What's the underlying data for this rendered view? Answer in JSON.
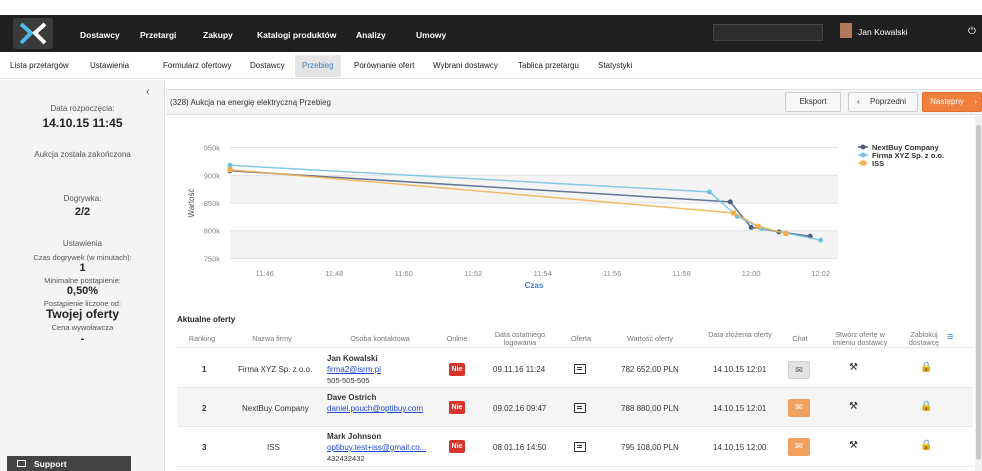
{
  "topnav": {
    "items": [
      "Dostawcy",
      "Przetargi",
      "Zakupy",
      "Katalogi produktów",
      "Analizy",
      "Umowy"
    ],
    "active": "Przetargi",
    "user_name": "Jan Kowalski"
  },
  "subnav": {
    "items": [
      "Lista przetargów",
      "Ustawienia",
      "Formularz ofertowy",
      "Dostawcy",
      "Przebieg",
      "Porównanie ofert",
      "Wybrani dostawcy",
      "Tablica przetargu",
      "Statystyki"
    ],
    "active": "Przebieg"
  },
  "sidebar": {
    "start_label": "Data rozpoczęcia:",
    "start_value": "14.10.15 11:45",
    "status": "Aukcja została zakończona",
    "overtime_label": "Dogrywka:",
    "overtime_value": "2/2",
    "settings_title": "Ustawienia",
    "overtime_time_label": "Czas dogrywek (w minutach):",
    "overtime_time_value": "1",
    "min_step_label": "Minimalne postąpienie:",
    "min_step_value": "0,50%",
    "step_from_label": "Postąpienie liczone od:",
    "step_from_value": "Twojej oferty",
    "start_price_label": "Cena wywoławcza",
    "start_price_value": "-",
    "support_label": "Support"
  },
  "header": {
    "title": "(328) Aukcja na energię elektryczną Przebieg",
    "export_label": "Eksport",
    "prev_label": "Poprzedni",
    "next_label": "Następny"
  },
  "chart_data": {
    "type": "line",
    "xlabel": "Czas",
    "ylabel": "Wartość",
    "x_ticks": [
      "11:46",
      "11:48",
      "11:50",
      "11:52",
      "11:54",
      "11:56",
      "11:58",
      "12:00",
      "12:02"
    ],
    "y_ticks": [
      "750k",
      "800k",
      "850k",
      "900k",
      "950k"
    ],
    "ylim": [
      740000,
      960000
    ],
    "xlim": [
      "11:45",
      "12:02.5"
    ],
    "grid": true,
    "legend_position": "top-right",
    "series": [
      {
        "name": "NextBuy Company",
        "color": "#4a5f80",
        "points": [
          [
            "11:45",
            908000
          ],
          [
            "11:59.4",
            852000
          ],
          [
            "12:00",
            806000
          ],
          [
            "12:00.8",
            798000
          ],
          [
            "12:01.7",
            790000
          ]
        ]
      },
      {
        "name": "Firma XYZ Sp. z o.o.",
        "color": "#6ec1e4",
        "points": [
          [
            "11:45",
            918000
          ],
          [
            "11:58.8",
            870000
          ],
          [
            "11:59.6",
            826000
          ],
          [
            "12:00.3",
            804000
          ],
          [
            "12:01",
            796000
          ],
          [
            "12:02",
            783000
          ]
        ]
      },
      {
        "name": "ISS",
        "color": "#f3b04c",
        "points": [
          [
            "11:45",
            910000
          ],
          [
            "11:59.5",
            832000
          ],
          [
            "12:00.2",
            808000
          ],
          [
            "12:01",
            795000
          ]
        ]
      }
    ]
  },
  "offers": {
    "section_title": "Aktualne oferty",
    "columns": [
      "Ranking",
      "Nazwa firmy",
      "Osoba kontaktowa",
      "Online",
      "Data ostatniego logowania",
      "Oferta",
      "Wartość oferty",
      "Data złożenia oferty",
      "Chat",
      "Stwórz ofertę w imieniu dostawcy",
      "Zablokuj dostawcę"
    ],
    "rows": [
      {
        "rank": "1",
        "company": "Firma XYZ Sp. z o.o.",
        "contact": "Jan Kowalski",
        "email": "firma2@isrm.pl",
        "phone": "505-505-505",
        "online": "Nie",
        "last_login": "09.11.16 11:24",
        "value": "782 652,00 PLN",
        "submitted": "14.10.15 12:01"
      },
      {
        "rank": "2",
        "company": "NextBuy Company",
        "contact": "Dave Ostrich",
        "email": "daniel.pouch@optibuy.com",
        "phone": "",
        "online": "Nie",
        "last_login": "09.02.16 09:47",
        "value": "788 880,00 PLN",
        "submitted": "14.10.15 12:01"
      },
      {
        "rank": "3",
        "company": "ISS",
        "contact": "Mark Johnson",
        "email": "optibuy.test+iss@gmail.co...",
        "phone": "432432432",
        "online": "Nie",
        "last_login": "08.01.16 14:50",
        "value": "795 108,00 PLN",
        "submitted": "14.10.15 12:00"
      }
    ]
  },
  "colors": {
    "accent": "#f07f3c",
    "topbar": "#1f1f1f",
    "badge_red": "#d9342b",
    "active_link": "#3d7fc4"
  }
}
